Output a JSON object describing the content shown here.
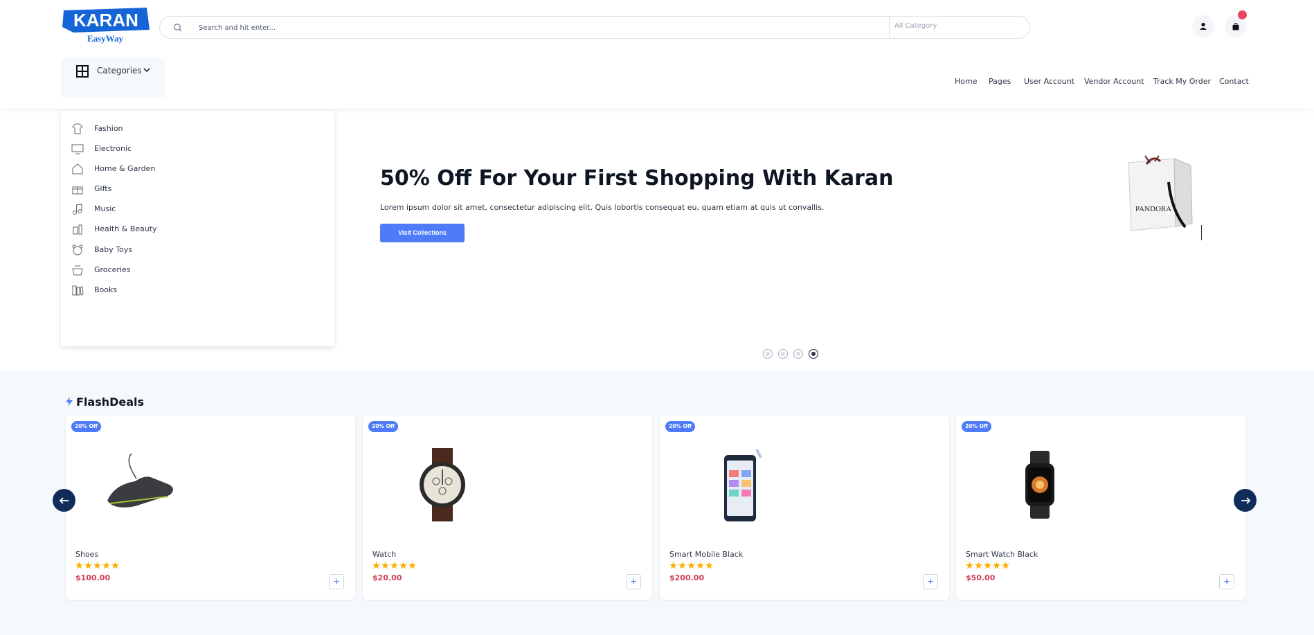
{
  "header": {
    "logo": {
      "brand": "KARAN",
      "tagline": "EasyWay"
    },
    "search": {
      "placeholder": "Search and hit enter...",
      "category": "All Category"
    },
    "nav": [
      "Home",
      "Pages",
      "User Account",
      "Vendor Account",
      "Track My Order",
      "Contact"
    ],
    "categories_label": "Categories"
  },
  "category_menu": [
    "Fashion",
    "Electronic",
    "Home & Garden",
    "Gifts",
    "Music",
    "Health & Beauty",
    "Baby Toys",
    "Groceries",
    "Books"
  ],
  "hero": {
    "title": "50% Off For Your First Shopping With Karan",
    "text": "Lorem ipsum dolor sit amet, consectetur adipiscing elit. Quis lobortis consequat eu, quam etiam at quis ut convallis.",
    "button": "Visit Collections",
    "bag_label": "PANDORA",
    "slides": 4,
    "active_slide": 4
  },
  "flash_deals": {
    "title": "FlashDeals",
    "products": [
      {
        "discount": "20% Off",
        "name": "Shoes",
        "rating": 5,
        "price": "$100.00"
      },
      {
        "discount": "20% Off",
        "name": "Watch",
        "rating": 5,
        "price": "$20.00"
      },
      {
        "discount": "20% Off",
        "name": "Smart Mobile Black",
        "rating": 5,
        "price": "$200.00"
      },
      {
        "discount": "20% Off",
        "name": "Smart Watch Black",
        "rating": 5,
        "price": "$50.00"
      }
    ]
  },
  "colors": {
    "accent": "#4e7bf7",
    "price": "#d23f57",
    "badge": "#e94560",
    "star": "#faaf00",
    "arrow": "#0f2c5a"
  }
}
